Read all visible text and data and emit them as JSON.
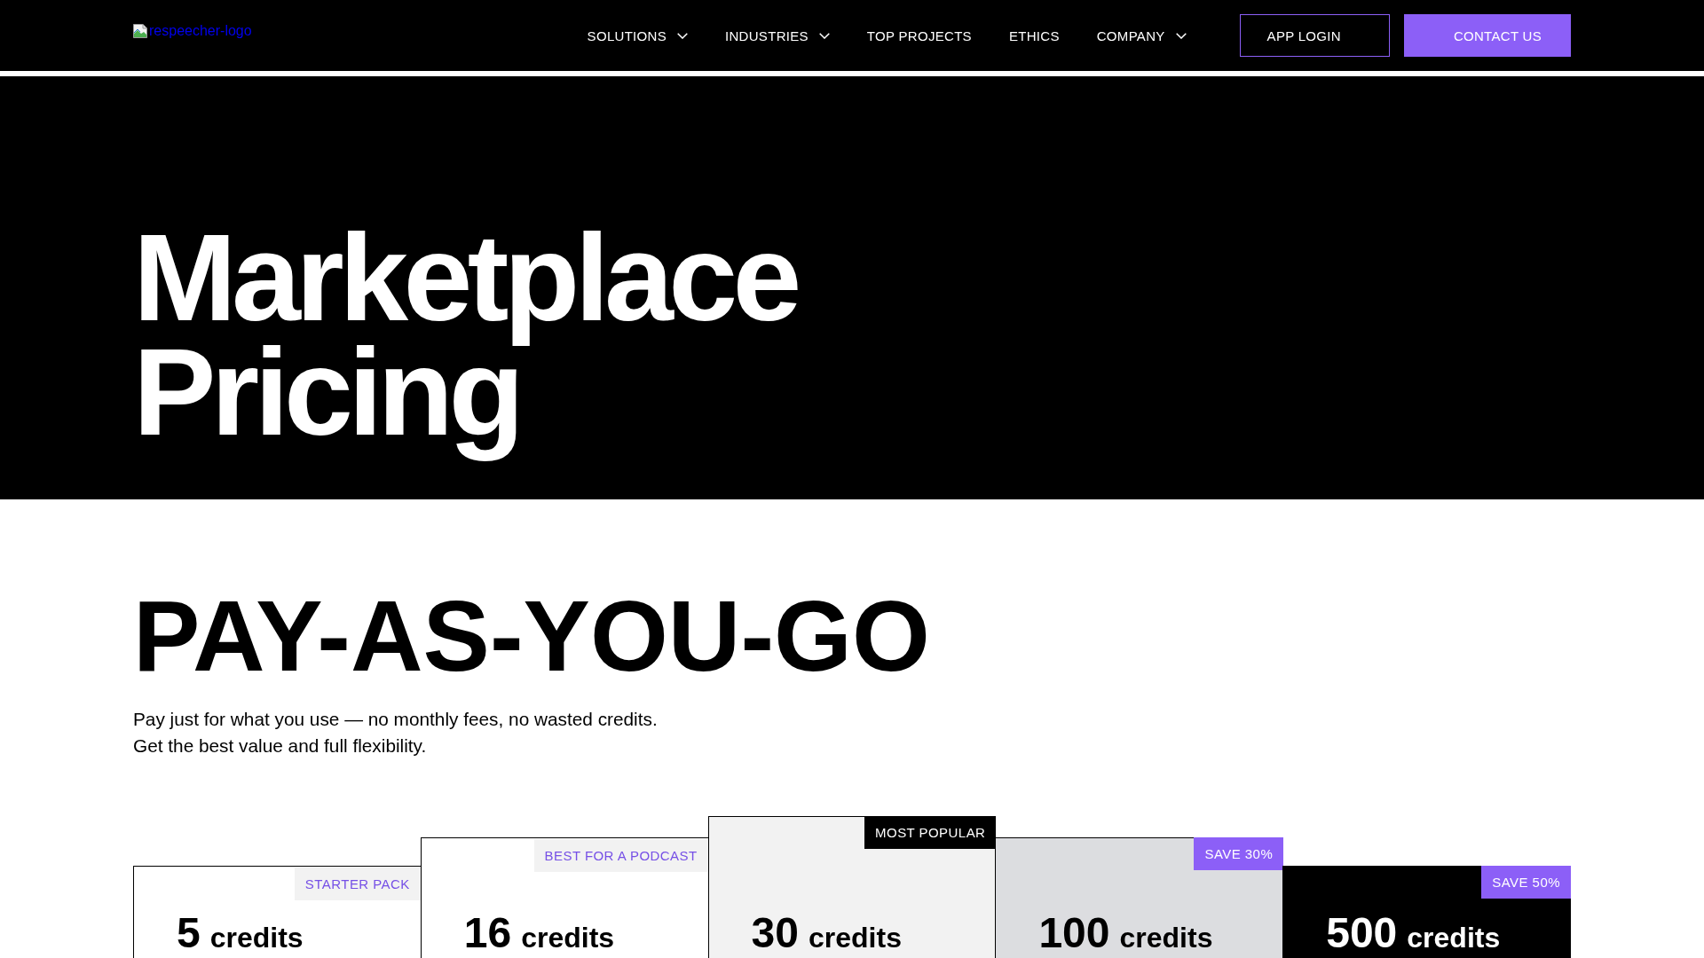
{
  "header": {
    "logo": {
      "alt": "respeecher-logo"
    },
    "nav": [
      {
        "label": "SOLUTIONS",
        "dropdown": true
      },
      {
        "label": "INDUSTRIES",
        "dropdown": true
      },
      {
        "label": "TOP PROJECTS",
        "dropdown": false
      },
      {
        "label": "ETHICS",
        "dropdown": false
      },
      {
        "label": "COMPANY",
        "dropdown": true
      }
    ],
    "buttons": [
      {
        "label": "APP LOGIN",
        "kind": "outline"
      },
      {
        "label": "CONTACT US",
        "kind": "filled"
      }
    ]
  },
  "hero": {
    "title": "Marketplace Pricing"
  },
  "pricing": {
    "title": "PAY-AS-YOU-GO",
    "description": "Pay just for what you use — no monthly fees, no wasted credits. Get the best value and full flexibility.",
    "cards": [
      {
        "kind": "standard",
        "badge": {
          "text": "STARTER PACK",
          "kind": "subtle"
        },
        "amount": "5",
        "unit": "credits"
      },
      {
        "kind": "standard",
        "badge": {
          "text": "BEST FOR A PODCAST",
          "kind": "subtle"
        },
        "amount": "16",
        "unit": "credits"
      },
      {
        "kind": "featured",
        "badge": {
          "text": "MOST POPULAR",
          "kind": "inverse"
        },
        "amount": "30",
        "unit": "credits"
      },
      {
        "kind": "value",
        "badge": {
          "text": "SAVE 30%",
          "kind": "accent"
        },
        "amount": "100",
        "unit": "credits"
      },
      {
        "kind": "premium",
        "badge": {
          "text": "SAVE 50%",
          "kind": "accent"
        },
        "amount": "500",
        "unit": "credits"
      }
    ]
  }
}
